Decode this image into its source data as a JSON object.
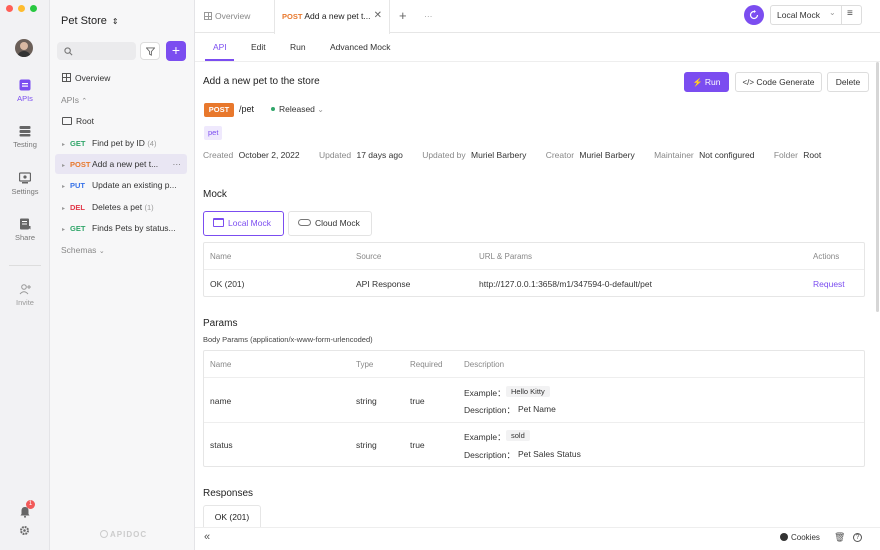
{
  "window": {
    "traffic_lights": [
      "#ff5f57",
      "#febc2e",
      "#28c840"
    ]
  },
  "rail": {
    "items": [
      {
        "label": "APIs",
        "icon": "apis-icon"
      },
      {
        "label": "Testing",
        "icon": "testing-icon"
      },
      {
        "label": "Settings",
        "icon": "settings-icon"
      },
      {
        "label": "Share",
        "icon": "share-icon"
      },
      {
        "label": "Invite",
        "icon": "invite-icon"
      }
    ],
    "notification_count": "1"
  },
  "project": {
    "name": "Pet Store"
  },
  "tree": {
    "overview": "Overview",
    "apis_label": "APIs",
    "root": "Root",
    "endpoints": [
      {
        "method": "GET",
        "name": "Find pet by ID",
        "count": "(4)"
      },
      {
        "method": "POST",
        "name": "Add a new pet t...",
        "count": ""
      },
      {
        "method": "PUT",
        "name": "Update an existing p...",
        "count": ""
      },
      {
        "method": "DEL",
        "name": "Deletes a pet",
        "count": "(1)"
      },
      {
        "method": "GET",
        "name": "Finds Pets by status...",
        "count": ""
      }
    ],
    "schemas": "Schemas",
    "footer_logo": "APIDOC"
  },
  "tabs": {
    "overview": "Overview",
    "active_method": "POST",
    "active_title": "Add a new pet t...",
    "env": "Local Mock"
  },
  "subtabs": [
    "API",
    "Edit",
    "Run",
    "Advanced Mock"
  ],
  "api": {
    "title": "Add a new pet to the store",
    "method": "POST",
    "path": "/pet",
    "status": "Released",
    "tag": "pet",
    "run": "Run",
    "code_generate": "Code Generate",
    "delete": "Delete"
  },
  "meta": [
    {
      "label": "Created",
      "value": "October 2, 2022"
    },
    {
      "label": "Updated",
      "value": "17 days ago"
    },
    {
      "label": "Updated by",
      "value": "Muriel Barbery"
    },
    {
      "label": "Creator",
      "value": "Muriel Barbery"
    },
    {
      "label": "Maintainer",
      "value": "Not configured"
    },
    {
      "label": "Folder",
      "value": "Root"
    }
  ],
  "mock": {
    "heading": "Mock",
    "local": "Local Mock",
    "cloud": "Cloud Mock",
    "headers": [
      "Name",
      "Source",
      "URL & Params",
      "Actions"
    ],
    "row": {
      "name": "OK (201)",
      "source": "API Response",
      "url": "http://127.0.0.1:3658/m1/347594-0-default/pet",
      "action": "Request"
    }
  },
  "params": {
    "heading": "Params",
    "sub": "Body Params (application/x-www-form-urlencoded)",
    "headers": [
      "Name",
      "Type",
      "Required",
      "Description"
    ],
    "rows": [
      {
        "name": "name",
        "type": "string",
        "required": "true",
        "example_label": "Example：",
        "example": "Hello Kitty",
        "desc_label": "Description：",
        "desc": "Pet Name"
      },
      {
        "name": "status",
        "type": "string",
        "required": "true",
        "example_label": "Example：",
        "example": "sold",
        "desc_label": "Description：",
        "desc": "Pet Sales Status"
      }
    ]
  },
  "responses": {
    "heading": "Responses",
    "tab": "OK (201)"
  },
  "footer": {
    "cookies": "Cookies"
  },
  "colors": {
    "accent": "#7b4df0",
    "post": "#e8782c",
    "get": "#31a66a",
    "put": "#3772e8",
    "del": "#e1394a"
  }
}
